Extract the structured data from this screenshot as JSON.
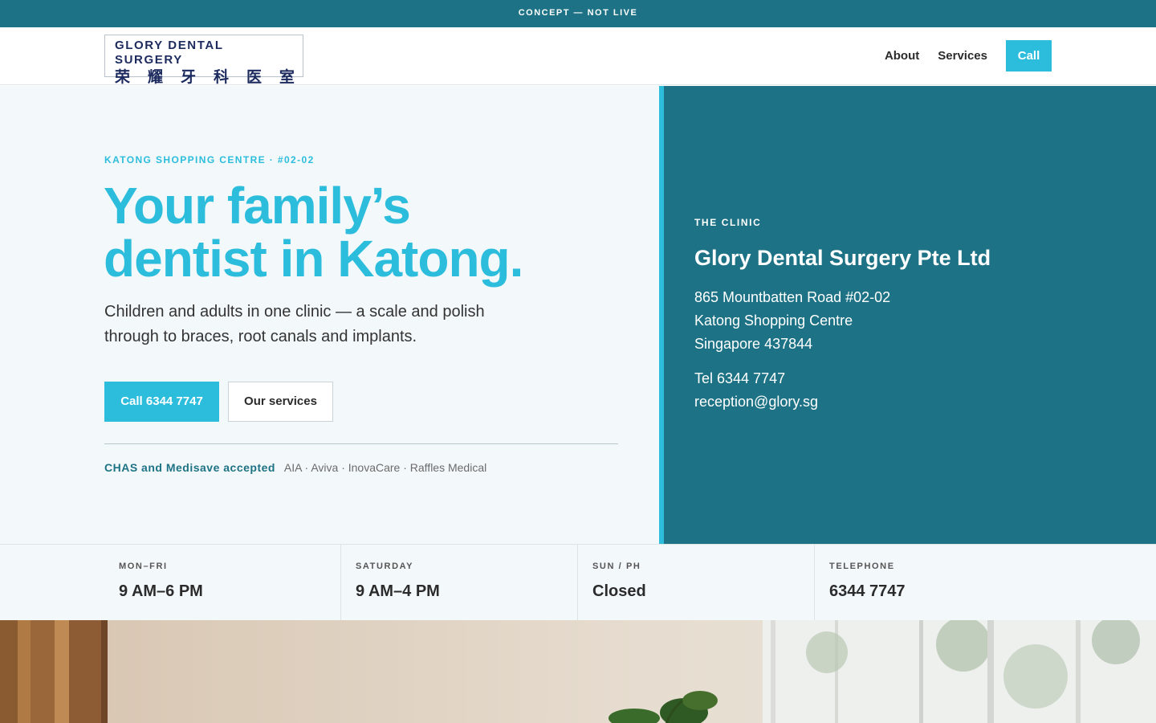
{
  "banner": {
    "text": "CONCEPT — NOT LIVE"
  },
  "header": {
    "logo": {
      "name_en": "GLORY DENTAL SURGERY",
      "name_zh": [
        "荣",
        "耀",
        "牙",
        "科",
        "医",
        "室"
      ]
    },
    "nav": {
      "about": "About",
      "services": "Services",
      "call": "Call"
    }
  },
  "hero": {
    "eyebrow": "KATONG SHOPPING CENTRE · #02-02",
    "title_line1": "Your family’s",
    "title_line2": "dentist in Katong.",
    "subtitle": "Children and adults in one clinic — a scale and polish through to braces, root canals and implants.",
    "primary_button": "Call 6344 7747",
    "secondary_button": "Our services",
    "insurance_highlight": "CHAS and Medisave accepted",
    "insurance_list": "AIA · Aviva · InovaCare · Raffles Medical"
  },
  "clinic": {
    "eyebrow": "THE CLINIC",
    "name": "Glory Dental Surgery Pte Ltd",
    "address": [
      "865 Mountbatten Road #02-02",
      "Katong Shopping Centre",
      "Singapore 437844"
    ],
    "tel": "Tel 6344 7747",
    "email": "reception@glory.sg"
  },
  "hours": [
    {
      "label": "MON–FRI",
      "value": "9 AM–6 PM"
    },
    {
      "label": "SATURDAY",
      "value": "9 AM–4 PM"
    },
    {
      "label": "SUN / PH",
      "value": "Closed"
    },
    {
      "label": "TELEPHONE",
      "value": "6344 7747"
    }
  ],
  "colors": {
    "brand_teal": "#1d7285",
    "accent_cyan": "#2cbddd",
    "navy_logo": "#1c2a5e",
    "light_bg": "#f3f8fa"
  },
  "icons": {
    "photo": "clinic-interior-photo"
  }
}
